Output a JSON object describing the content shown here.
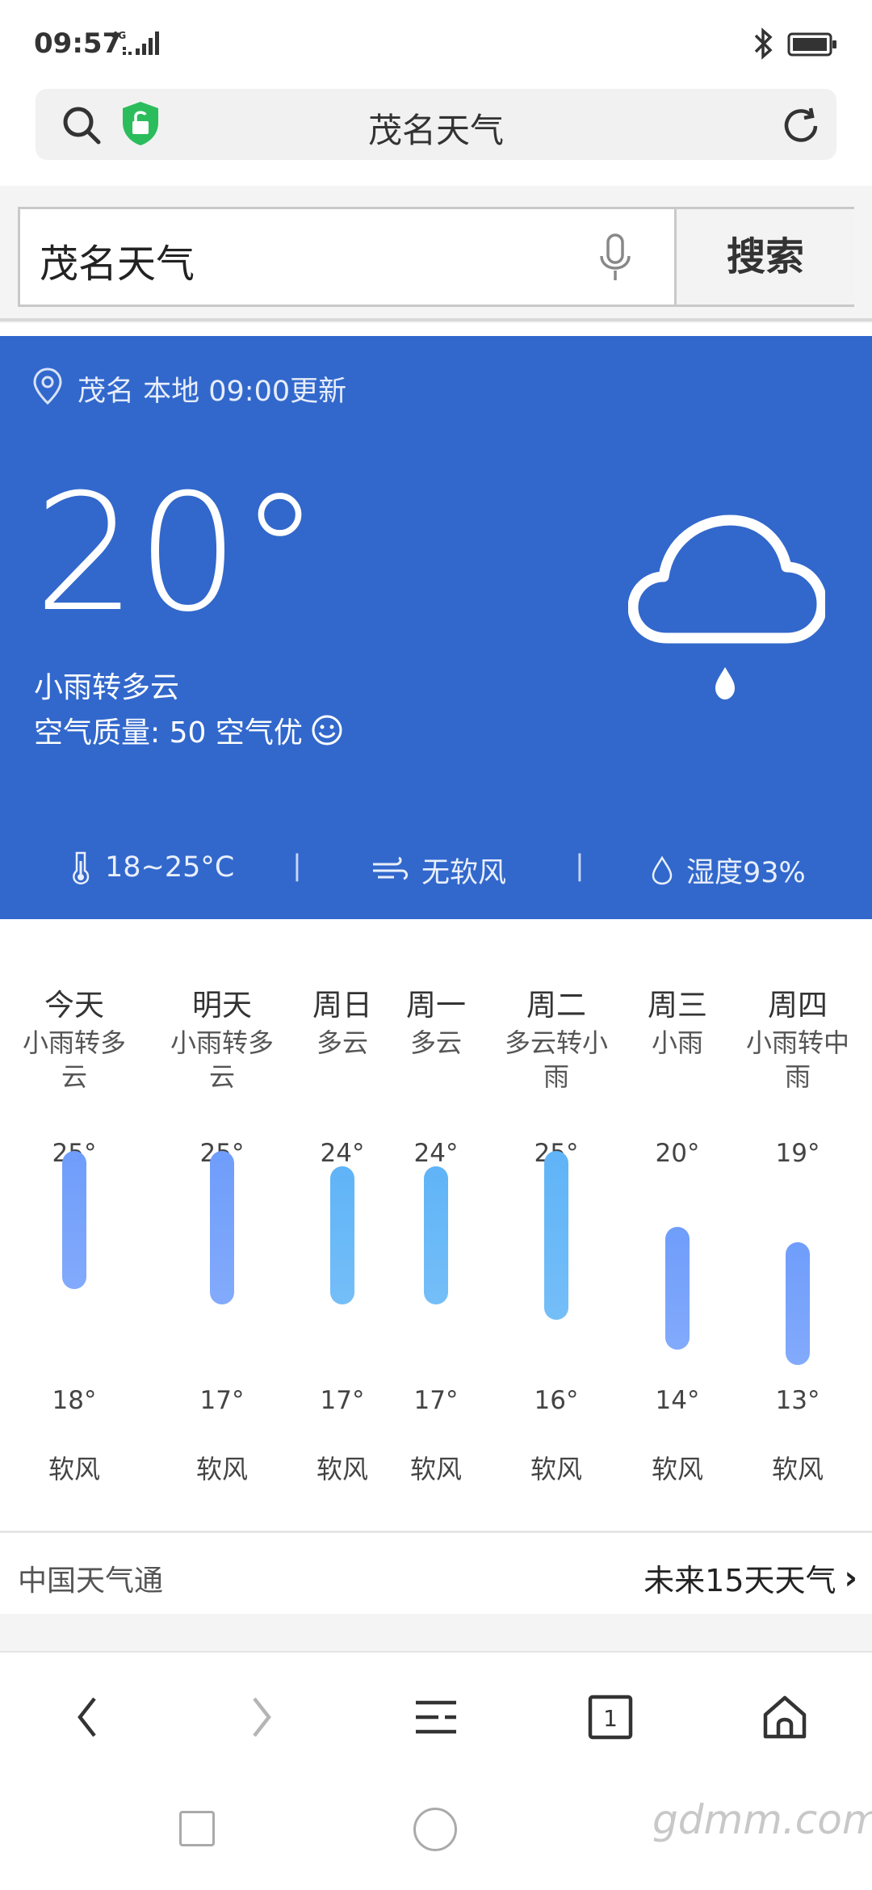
{
  "status_bar": {
    "time": "09:57",
    "network": "4G"
  },
  "address_bar": {
    "title": "茂名天气"
  },
  "search": {
    "query": "茂名天气",
    "button_label": "搜索"
  },
  "weather": {
    "location_line": "茂名 本地 09:00更新",
    "temperature": "20°",
    "condition": "小雨转多云",
    "air_quality": "空气质量: 50 空气优",
    "temp_range": "18~25°C",
    "wind": "无软风",
    "humidity": "湿度93%",
    "separator": "|",
    "card_color": "#3268cc"
  },
  "forecast": [
    {
      "day": "今天",
      "cond": "小雨转多云",
      "high": "25°",
      "low": "18°",
      "wind": "软风",
      "high_val": 25,
      "low_val": 18
    },
    {
      "day": "明天",
      "cond": "小雨转多云",
      "high": "25°",
      "low": "17°",
      "wind": "软风",
      "high_val": 25,
      "low_val": 17
    },
    {
      "day": "周日",
      "cond": "多云",
      "high": "24°",
      "low": "17°",
      "wind": "软风",
      "high_val": 24,
      "low_val": 17
    },
    {
      "day": "周一",
      "cond": "多云",
      "high": "24°",
      "low": "17°",
      "wind": "软风",
      "high_val": 24,
      "low_val": 17
    },
    {
      "day": "周二",
      "cond": "多云转小雨",
      "high": "25°",
      "low": "16°",
      "wind": "软风",
      "high_val": 25,
      "low_val": 16
    },
    {
      "day": "周三",
      "cond": "小雨",
      "high": "20°",
      "low": "14°",
      "wind": "软风",
      "high_val": 20,
      "low_val": 14
    },
    {
      "day": "周四",
      "cond": "小雨转中雨",
      "high": "19°",
      "low": "13°",
      "wind": "软风",
      "high_val": 19,
      "low_val": 13
    }
  ],
  "footer": {
    "source": "中国天气通",
    "more_link": "未来15天天气"
  },
  "bottom_nav": {
    "tab_count": "1"
  },
  "watermark": "gdmm.com"
}
